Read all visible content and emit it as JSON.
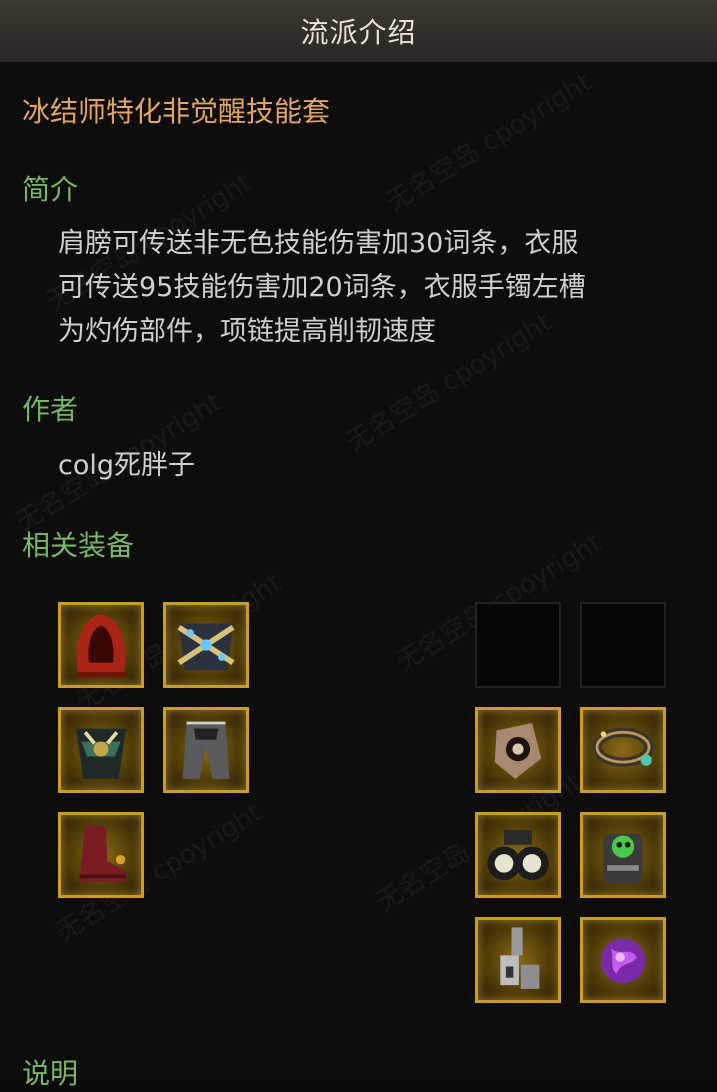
{
  "header": {
    "title": "流派介绍"
  },
  "build": {
    "title": "冰结师特化非觉醒技能套"
  },
  "intro": {
    "label": "简介",
    "lines": [
      "肩膀可传送非无色技能伤害加30词条，衣服",
      "可传送95技能伤害加20词条，衣服手镯左槽",
      "为灼伤部件，项链提高削韧速度"
    ]
  },
  "author": {
    "label": "作者",
    "name": "colg死胖子"
  },
  "equipment": {
    "label": "相关装备",
    "left_icons": [
      "hood-icon",
      "shoulder-armor-icon",
      "belt-icon",
      "pants-icon",
      "boots-icon"
    ],
    "right_icons": [
      "empty-slot",
      "empty-slot",
      "ring-icon",
      "bracelet-icon",
      "binoculars-icon",
      "gear-earring-icon",
      "clip-accessory-icon",
      "purple-gem-icon"
    ]
  },
  "notes": {
    "label": "说明"
  },
  "watermark": "无名空岛 cpoyright"
}
